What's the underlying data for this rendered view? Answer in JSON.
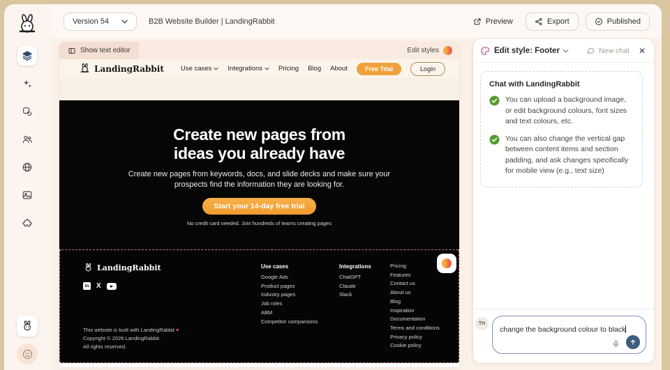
{
  "topbar": {
    "version_label": "Version 54",
    "title": "B2B Website Builder | LandingRabbit",
    "preview_label": "Preview",
    "export_label": "Export",
    "published_label": "Published"
  },
  "sidebar": {
    "icons": [
      "layers",
      "sparkles",
      "pages",
      "users",
      "globe",
      "image",
      "puzzle"
    ],
    "bottom_icons": [
      "rabbit",
      "smiley"
    ]
  },
  "canvas_toolbar": {
    "show_text_editor_label": "Show text editor",
    "edit_styles_label": "Edit styles"
  },
  "site": {
    "brand": "LandingRabbit",
    "nav": [
      "Use cases",
      "Integrations",
      "Pricing",
      "Blog",
      "About"
    ],
    "free_trial_label": "Free Trial",
    "login_label": "Login",
    "hero": {
      "heading_line1": "Create new pages from",
      "heading_line2": "ideas you already have",
      "subtitle": "Create new pages from keywords, docs, and slide decks and make sure your prospects find the information they are looking for.",
      "cta_label": "Start your 14-day free trial",
      "caption": "No credit card needed. Join hundreds of teams creating pages"
    },
    "footer": {
      "brand": "LandingRabbit",
      "socials": [
        "linkedin",
        "x",
        "youtube"
      ],
      "columns": [
        {
          "title": "Use cases",
          "links": [
            "Google Ads",
            "Product pages",
            "Industry pages",
            "Job roles",
            "ABM",
            "Competitor comparisons"
          ]
        },
        {
          "title": "Integrations",
          "links": [
            "ChatGPT",
            "Claude",
            "Slack"
          ]
        },
        {
          "title": "",
          "links": [
            "Pricing",
            "Features",
            "Contact us",
            "About us",
            "Blog",
            "Inspiration",
            "Documentation",
            "Terms and conditions",
            "Privacy policy",
            "Cookie policy"
          ]
        }
      ],
      "built_with": "This website is built with LandingRabbit",
      "heart": "♥",
      "copyright": "Copyright © 2026 LandingRabbit.",
      "rights": "All rights reserved."
    }
  },
  "panel": {
    "title": "Edit style: Footer",
    "new_chat_label": "New chat",
    "close_label": "✕",
    "chat": {
      "title": "Chat with LandingRabbit",
      "bullets": [
        "You can upload a background image, or edit background colours, font sizes and text colours, etc.",
        "You can also change the vertical gap between content items and section padding, and ask changes specifically for mobile view (e.g., text size)"
      ]
    },
    "input": {
      "avatar": "TH",
      "value": "change the background colour to black"
    }
  },
  "colors": {
    "brand_orange": "#efa23c",
    "selection_dashed": "#c17c82",
    "send_button": "#3f5d7d",
    "check_green": "#559b2e",
    "swatch_gradient": [
      "#f5a93f",
      "#ee5f46"
    ],
    "hero_background": "#060606",
    "workspace_background": "#fbf1e9",
    "outer_background": "#d9c6a0"
  }
}
